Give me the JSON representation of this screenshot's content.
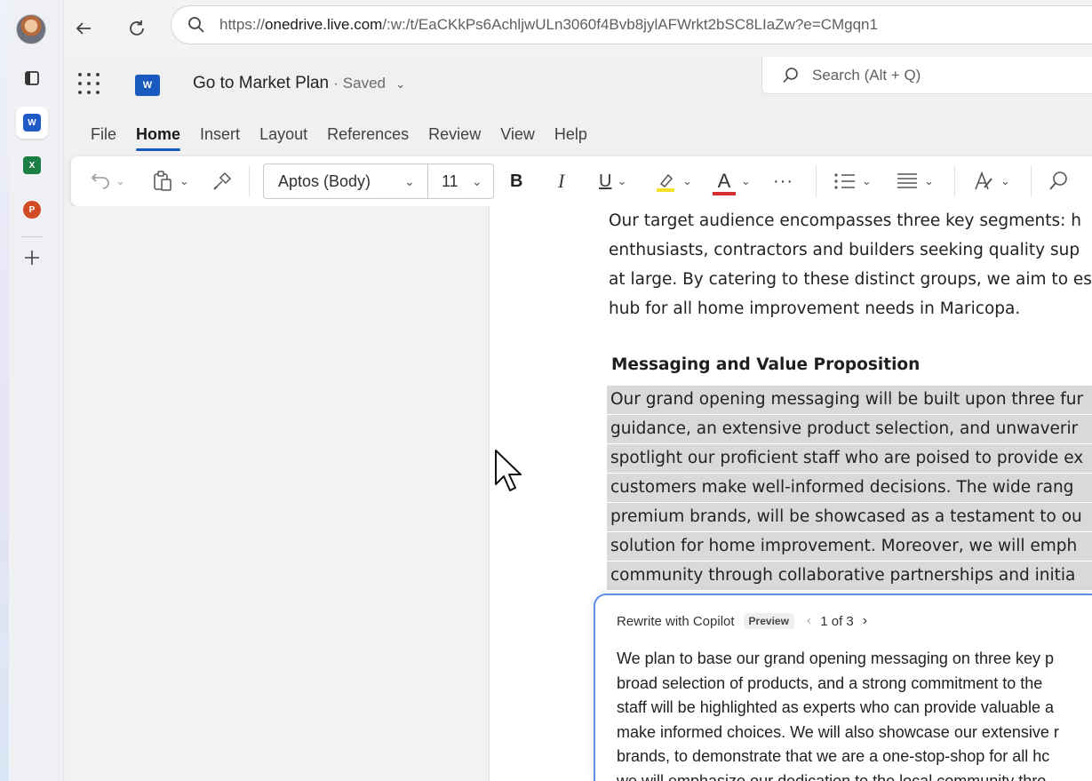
{
  "browser": {
    "url_prefix": "https://",
    "url_domain": "onedrive.live.com",
    "url_rest": "/:w:/t/EaCKkPs6AchljwULn3060f4Bvb8jylAFWrkt2bSC8LIaZw?e=CMgqn1"
  },
  "rail": {
    "apps": [
      "Word",
      "Excel",
      "PowerPoint"
    ],
    "word_letter": "W",
    "excel_letter": "X",
    "ppt_letter": "P"
  },
  "word": {
    "logo_letter": "W",
    "doc_title": "Go to Market Plan",
    "doc_status": "· Saved",
    "search_placeholder": "Search (Alt + Q)",
    "tabs": [
      "File",
      "Home",
      "Insert",
      "Layout",
      "References",
      "Review",
      "View",
      "Help"
    ],
    "active_tab": "Home",
    "ribbon": {
      "font_name": "Aptos (Body)",
      "font_size": "11",
      "bold": "B",
      "italic": "I",
      "underline": "U",
      "font_color": "A",
      "more": "···"
    }
  },
  "document": {
    "intro_lines": [
      "Our target audience encompasses three key segments: h",
      "enthusiasts, contractors and builders seeking quality sup",
      "at large. By catering to these distinct groups, we aim to es",
      "hub for all home improvement needs in Maricopa."
    ],
    "heading": "Messaging and Value Proposition",
    "selected_lines": [
      "Our grand opening messaging will be built upon three fur",
      "guidance, an extensive product selection, and unwaverir",
      "spotlight our proficient staff who are poised to provide ex",
      "customers make well-informed decisions. The wide rang",
      "premium brands, will be showcased as a testament to ou",
      "solution for home improvement. Moreover, we will emph",
      "community through collaborative partnerships and initia"
    ]
  },
  "copilot": {
    "title": "Rewrite with Copilot",
    "badge": "Preview",
    "counter": "1 of 3",
    "lines": [
      "We plan to base our grand opening messaging on three key p",
      "broad selection of products, and a strong commitment to the",
      "staff will be highlighted as experts who can provide valuable a",
      "make informed choices. We will also showcase our extensive r",
      "brands, to demonstrate that we are a one-stop-shop for all hc",
      "we will emphasize our dedication to the local community thro"
    ]
  },
  "colors": {
    "accent": "#185abd",
    "copilot_border": "#5b8de0",
    "selection": "#d9d9d9",
    "highlight_yellow": "#f5e12a",
    "font_red": "#d32f2f"
  }
}
